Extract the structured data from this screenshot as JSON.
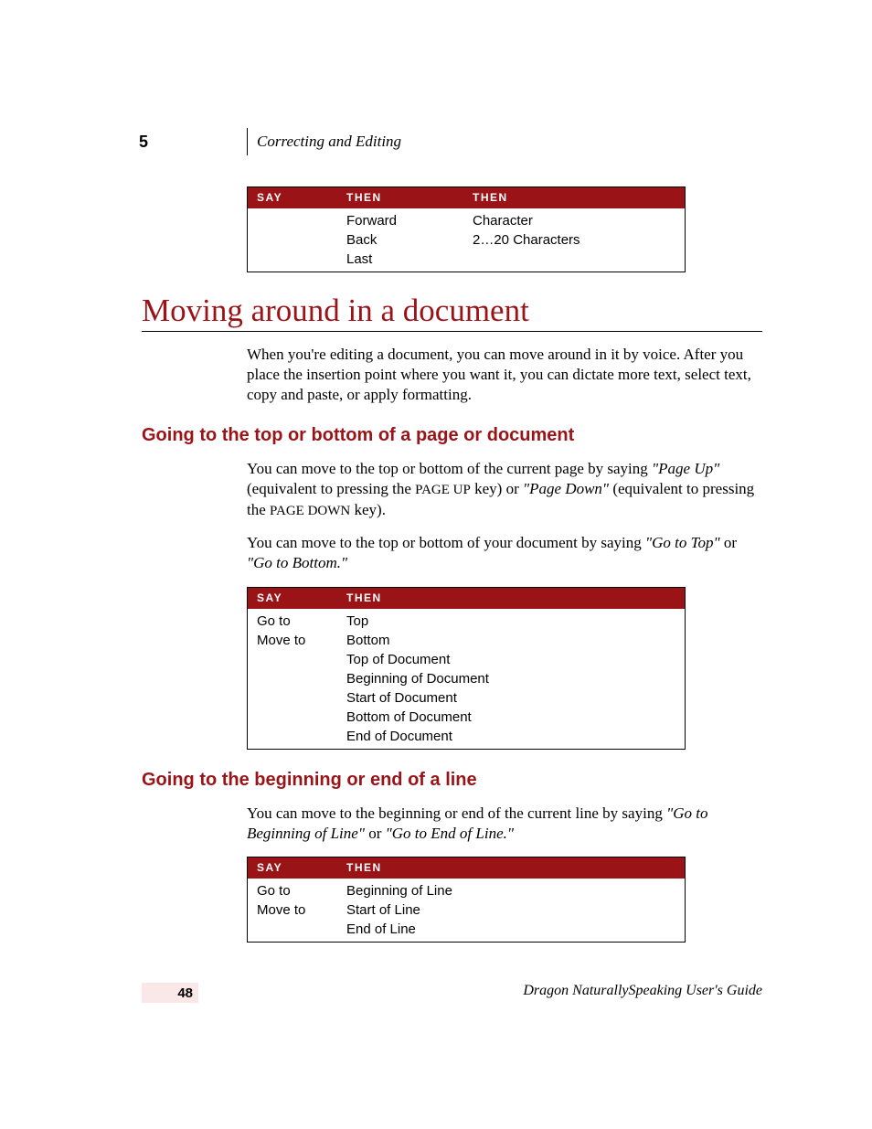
{
  "chapter": {
    "number": "5",
    "title": "Correcting and Editing"
  },
  "table1": {
    "headers": [
      "Say",
      "Then",
      "Then"
    ],
    "rows": [
      [
        "",
        "Forward",
        "Character"
      ],
      [
        "",
        "Back",
        "2…20 Characters"
      ],
      [
        "",
        "Last",
        ""
      ]
    ]
  },
  "mainHeading": "Moving around in a document",
  "intro": "When you're editing a document, you can move around in it by voice. After you place the insertion point where you want it, you can dictate more text, select text, copy and paste, or apply formatting.",
  "sectionA": {
    "heading": "Going to the top or bottom of a page or document",
    "p1_a": "You can move to the top or bottom of the current page by saying ",
    "p1_q1": "\"Page Up\"",
    "p1_b": " (equivalent to pressing the ",
    "p1_key1a": "PAGE",
    "p1_key1b": " UP",
    "p1_c": " key) or ",
    "p1_q2": "\"Page Down\"",
    "p1_d": " (equivalent to pressing the ",
    "p1_key2a": "PAGE",
    "p1_key2b": " DOWN",
    "p1_e": " key).",
    "p2_a": "You can move to the top or bottom of your document by saying ",
    "p2_q1": "\"Go to Top\"",
    "p2_b": " or ",
    "p2_q2": "\"Go to Bottom.\""
  },
  "table2": {
    "headers": [
      "Say",
      "Then"
    ],
    "rows": [
      [
        "Go to",
        "Top"
      ],
      [
        "Move to",
        "Bottom"
      ],
      [
        "",
        "Top of Document"
      ],
      [
        "",
        "Beginning of Document"
      ],
      [
        "",
        "Start of Document"
      ],
      [
        "",
        "Bottom of Document"
      ],
      [
        "",
        "End of Document"
      ]
    ]
  },
  "sectionB": {
    "heading": "Going to the beginning or end of a line",
    "p1_a": "You can move to the beginning or end of the current line by saying ",
    "p1_q1": "\"Go to Beginning of Line\"",
    "p1_b": " or ",
    "p1_q2": "\"Go to End of Line.\""
  },
  "table3": {
    "headers": [
      "Say",
      "Then"
    ],
    "rows": [
      [
        "Go to",
        "Beginning of Line"
      ],
      [
        "Move to",
        "Start of Line"
      ],
      [
        "",
        "End of Line"
      ]
    ]
  },
  "footer": {
    "pageNumber": "48",
    "bookTitle": "Dragon NaturallySpeaking User's Guide"
  }
}
